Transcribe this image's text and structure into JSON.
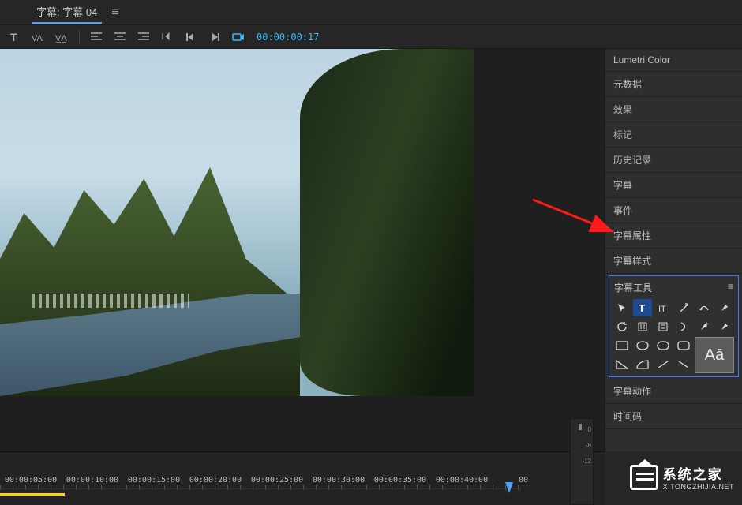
{
  "tab": {
    "title": "字幕: 字幕 04"
  },
  "toolbar": {
    "timecode": "00:00:00:17"
  },
  "side_items": [
    {
      "label": "Lumetri Color"
    },
    {
      "label": "元数据"
    },
    {
      "label": "效果"
    },
    {
      "label": "标记"
    },
    {
      "label": "历史记录"
    },
    {
      "label": "字幕"
    },
    {
      "label": "事件"
    },
    {
      "label": "字幕属性"
    },
    {
      "label": "字幕样式"
    }
  ],
  "tools_panel": {
    "title": "字幕工具",
    "aa": "Aā"
  },
  "side_items_after": [
    {
      "label": "字幕动作"
    },
    {
      "label": "时间码"
    }
  ],
  "timeline": {
    "ticks": [
      "00:00:05:00",
      "00:00:10:00",
      "00:00:15:00",
      "00:00:20:00",
      "00:00:25:00",
      "00:00:30:00",
      "00:00:35:00",
      "00:00:40:00",
      "00"
    ]
  },
  "vu": {
    "labels": [
      "0",
      "-6",
      "-12"
    ]
  },
  "watermark": {
    "cn": "系统之家",
    "en": "XITONGZHIJIA.NET"
  }
}
